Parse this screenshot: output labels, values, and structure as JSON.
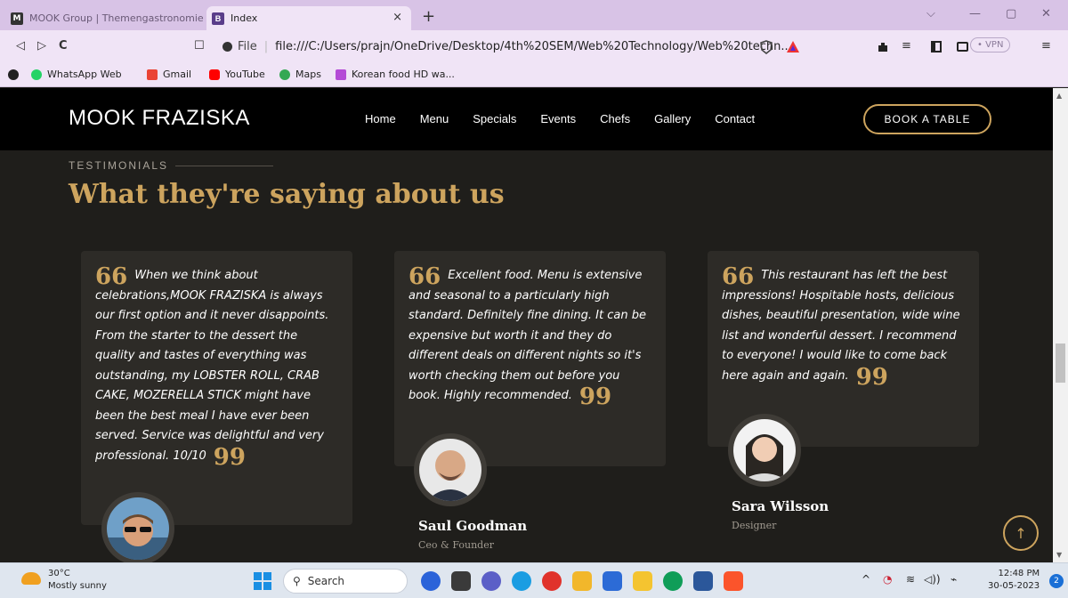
{
  "browser": {
    "tabs": [
      {
        "title": "MOOK Group | Themengastronomie a",
        "favicon": "M",
        "active": false
      },
      {
        "title": "Index",
        "favicon": "B",
        "active": true
      }
    ],
    "tab_close": "×",
    "new_tab": "+",
    "window_controls": [
      "⌵",
      "—",
      "▢",
      "✕"
    ],
    "nav_icons": {
      "back": "◁",
      "forward": "▷",
      "reload": "C",
      "bookmark": "☐"
    },
    "url_scheme_label": "File",
    "url": "file:///C:/Users/prajn/OneDrive/Desktop/4th%20SEM/Web%20Technology/Web%20techn...",
    "vpn_label": "• VPN",
    "bookmarks": [
      {
        "label": "WhatsApp Web",
        "color": "#25d366"
      },
      {
        "label": "Gmail",
        "color": "#ea4335"
      },
      {
        "label": "YouTube",
        "color": "#ff0000"
      },
      {
        "label": "Maps",
        "color": "#34a853"
      },
      {
        "label": "Korean food HD wa...",
        "color": "#b44bd6"
      }
    ]
  },
  "site": {
    "logo": "MOOK FRAZISKA",
    "nav": [
      "Home",
      "Menu",
      "Specials",
      "Events",
      "Chefs",
      "Gallery",
      "Contact"
    ],
    "cta": "BOOK A TABLE",
    "accent": "#cda45e"
  },
  "testimonials": {
    "label": "TESTIMONIALS",
    "title": "What they're saying about us",
    "open_quote": "66",
    "close_quote": "99",
    "items": [
      {
        "text": "When we think about celebrations,MOOK FRAZISKA is always our first option and it never disappoints. From the starter to the dessert the quality and tastes of everything was outstanding, my LOBSTER ROLL, CRAB CAKE, MOZERELLA STICK might have been the best meal I have ever been served. Service was delightful and very professional. 10/10",
        "name": "",
        "role": ""
      },
      {
        "text": "Excellent food. Menu is extensive and seasonal to a particularly high standard. Definitely fine dining. It can be expensive but worth it and they do different deals on different nights so it's worth checking them out before you book. Highly recommended.",
        "name": "Saul Goodman",
        "role": "Ceo & Founder"
      },
      {
        "text": "This restaurant has left the best impressions! Hospitable hosts, delicious dishes, beautiful presentation, wide wine list and wonderful dessert. I recommend to everyone! I would like to come back here again and again.",
        "name": "Sara Wilsson",
        "role": "Designer"
      }
    ],
    "back_to_top": "↑"
  },
  "taskbar": {
    "temperature": "30°C",
    "condition": "Mostly sunny",
    "search_label": "Search",
    "time": "12:48 PM",
    "date": "30-05-2023",
    "notifications": "2",
    "tray_icons": [
      "^",
      "◔",
      "≋",
      "◁))",
      "⌁"
    ],
    "apps": [
      {
        "name": "meet",
        "color": "#2b63d9"
      },
      {
        "name": "files",
        "color": "#3a3a3a"
      },
      {
        "name": "chat",
        "color": "#5b5fc7"
      },
      {
        "name": "edge",
        "color": "#1b9de2"
      },
      {
        "name": "music",
        "color": "#e0322b"
      },
      {
        "name": "explorer",
        "color": "#f2b72b"
      },
      {
        "name": "store",
        "color": "#2c6bd6"
      },
      {
        "name": "sticky",
        "color": "#f4c430"
      },
      {
        "name": "edge-dev",
        "color": "#0f9d58"
      },
      {
        "name": "word",
        "color": "#2b579a"
      },
      {
        "name": "brave",
        "color": "#fb542b"
      }
    ]
  }
}
